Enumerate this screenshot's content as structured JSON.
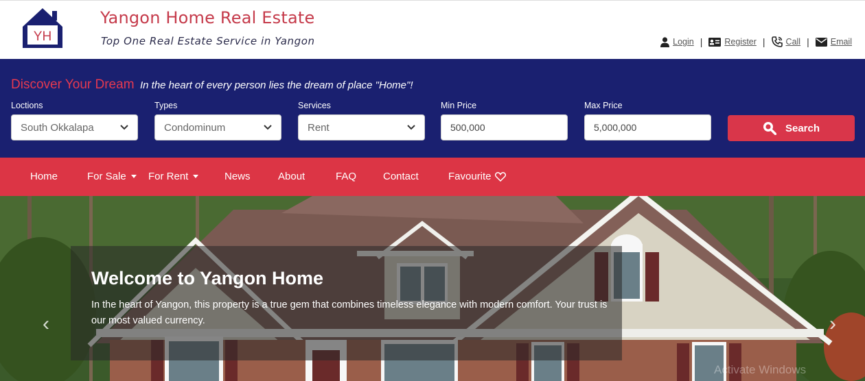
{
  "brand": {
    "logo_text": "YH",
    "title": "Yangon Home Real Estate",
    "tagline": "Top One Real Estate Service in Yangon"
  },
  "auth": {
    "login": "Login",
    "register": "Register",
    "call": "Call",
    "email": "Email",
    "separator": "|"
  },
  "search": {
    "headline": "Discover Your Dream",
    "subheadline": "In the heart of every person lies the dream of place \"Home\"!",
    "fields": {
      "location": {
        "label": "Loctions",
        "value": "South Okkalapa"
      },
      "type": {
        "label": "Types",
        "value": "Condominum"
      },
      "service": {
        "label": "Services",
        "value": "Rent"
      },
      "min_price": {
        "label": "Min Price",
        "value": "500,000"
      },
      "max_price": {
        "label": "Max Price",
        "value": "5,000,000"
      }
    },
    "button": "Search"
  },
  "nav": {
    "items": [
      "Home",
      "For Sale",
      "For Rent",
      "News",
      "About",
      "FAQ",
      "Contact",
      "Favourite"
    ]
  },
  "hero": {
    "title": "Welcome to Yangon Home",
    "description": "In the heart of Yangon, this property is a true gem that combines timeless elegance with modern comfort. Your trust is our most valued currency.",
    "prev": "‹",
    "next": "›",
    "watermark": "Activate Windows"
  },
  "colors": {
    "navy": "#1a2070",
    "red": "#dc3545",
    "brand_red": "#c53a4a"
  }
}
